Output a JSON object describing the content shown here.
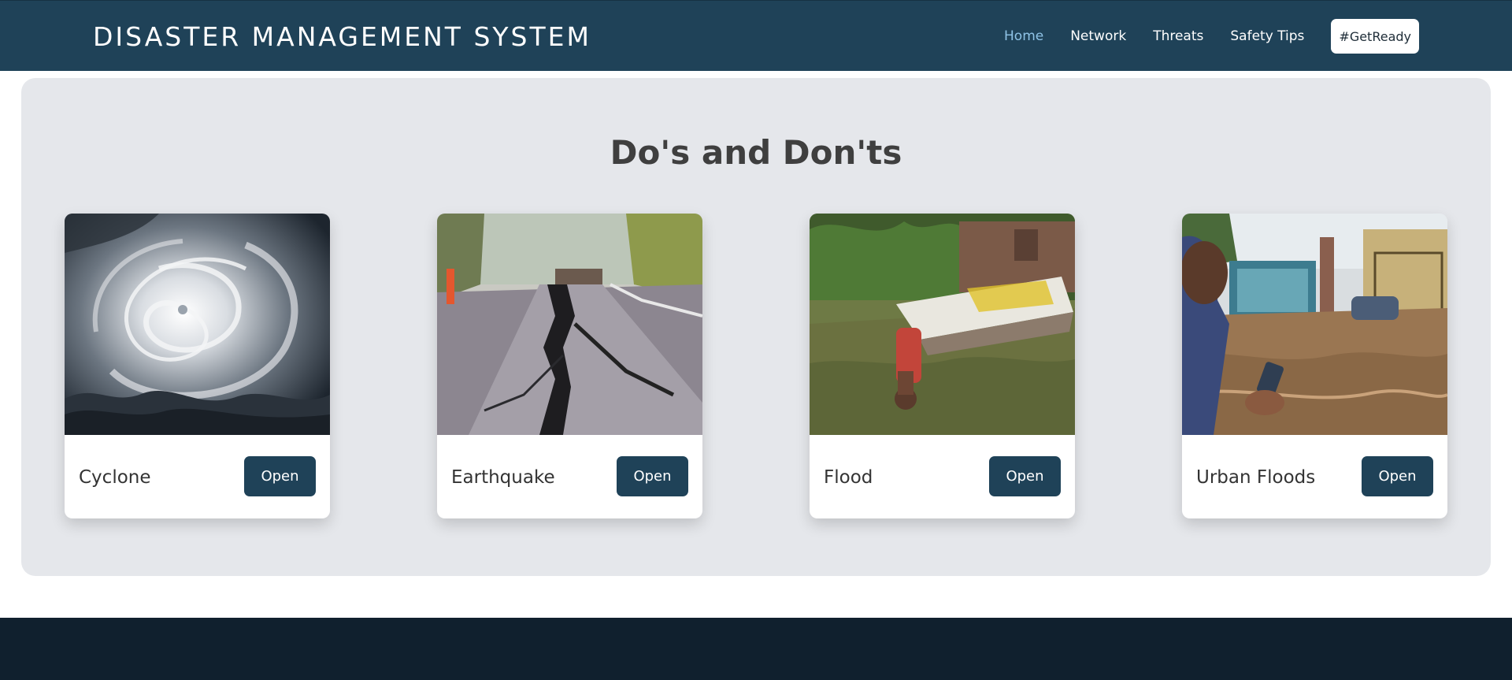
{
  "header": {
    "brand": "DISASTER MANAGEMENT SYSTEM",
    "nav": [
      {
        "label": "Home",
        "active": true
      },
      {
        "label": "Network",
        "active": false
      },
      {
        "label": "Threats",
        "active": false
      },
      {
        "label": "Safety Tips",
        "active": false
      }
    ],
    "cta_label": "#GetReady"
  },
  "main": {
    "title": "Do's and Don'ts",
    "cards": [
      {
        "title": "Cyclone",
        "button": "Open",
        "image": "cyclone-satellite-image"
      },
      {
        "title": "Earthquake",
        "button": "Open",
        "image": "cracked-road-image"
      },
      {
        "title": "Flood",
        "button": "Open",
        "image": "flooded-village-image"
      },
      {
        "title": "Urban Floods",
        "button": "Open",
        "image": "flooded-street-image"
      }
    ]
  },
  "colors": {
    "primary": "#1f4258",
    "nav_active": "#8fc3e6",
    "section_bg": "#e5e7eb",
    "footer_bg": "#10202e"
  }
}
